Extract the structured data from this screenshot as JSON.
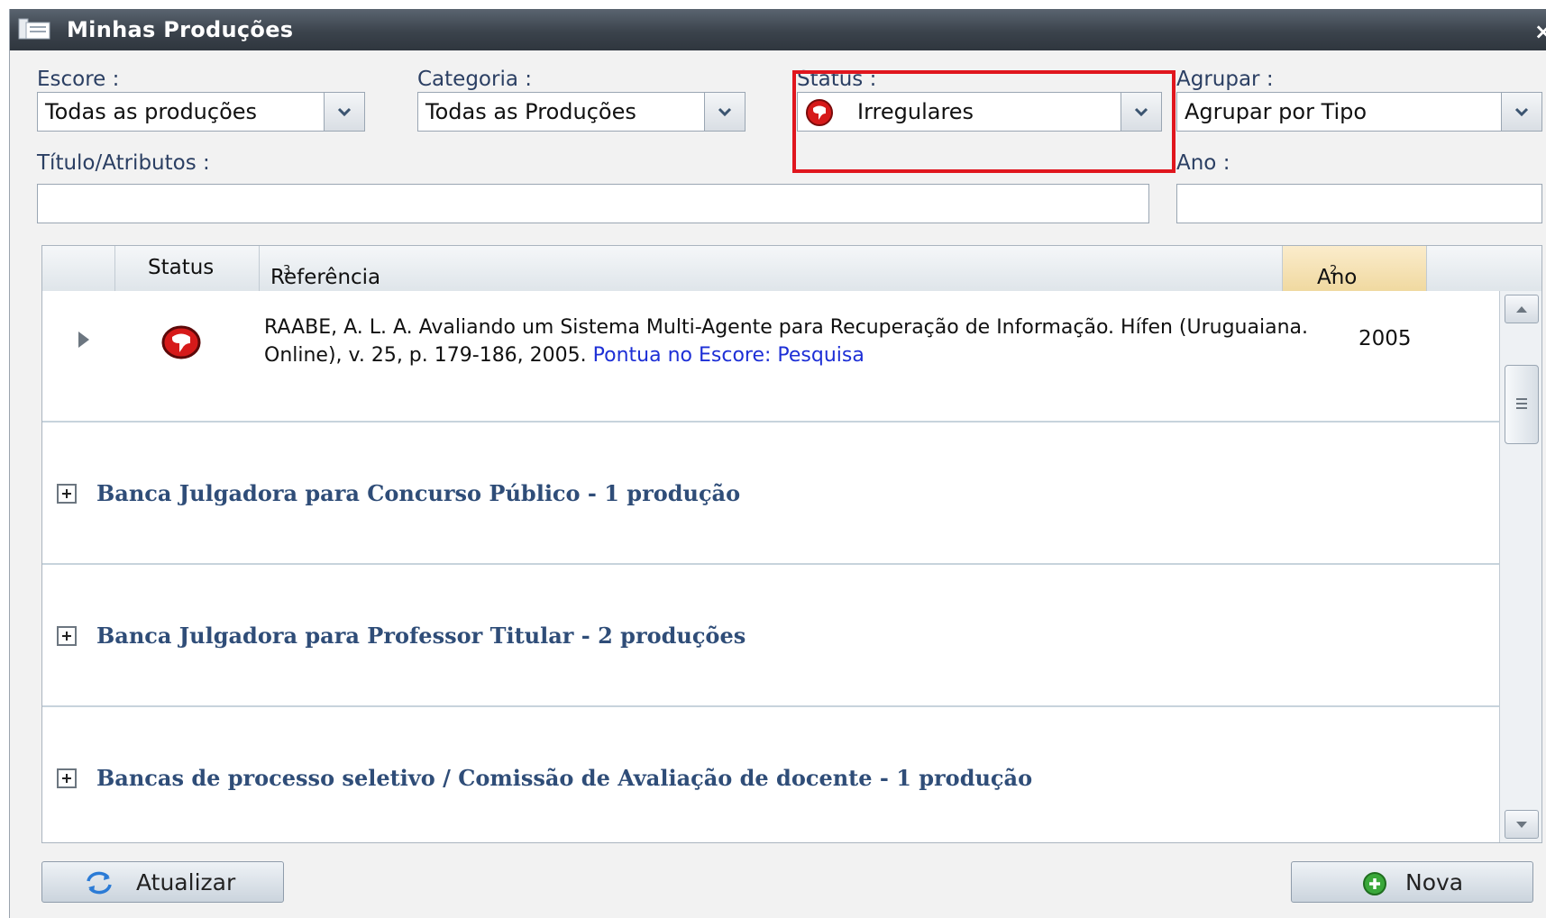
{
  "window": {
    "title": "Minhas Produções",
    "close_glyph": "×"
  },
  "filters": {
    "escore": {
      "label": "Escore :",
      "value": "Todas as produções"
    },
    "categoria": {
      "label": "Categoria :",
      "value": "Todas as Produções"
    },
    "status": {
      "label": "Status :",
      "value": "Irregulares",
      "icon": "irregular-status-icon"
    },
    "agrupar": {
      "label": "Agrupar :",
      "value": "Agrupar por Tipo"
    },
    "titulo": {
      "label": "Título/Atributos :",
      "value": ""
    },
    "ano": {
      "label": "Ano :",
      "value": ""
    }
  },
  "grid": {
    "columns": [
      {
        "label": ""
      },
      {
        "label": "Status"
      },
      {
        "label": "Referência",
        "sort_index": "3"
      },
      {
        "label": "Ano",
        "sort_index": "2"
      }
    ],
    "rows": [
      {
        "status_icon": "irregular-status-icon",
        "reference": "RAABE, A. L. A. Avaliando um Sistema Multi-Agente para Recuperação de Informação. Hífen (Uruguaiana. Online), v. 25, p. 179-186, 2005.",
        "link": "Pontua no Escore: Pesquisa",
        "year": "2005"
      }
    ],
    "groups": [
      {
        "label": "Banca Julgadora para Concurso Público - 1 produção"
      },
      {
        "label": "Banca Julgadora para Professor Titular - 2 produções"
      },
      {
        "label": "Bancas de processo seletivo / Comissão de Avaliação de docente - 1 produção"
      }
    ]
  },
  "buttons": {
    "refresh": {
      "label": "Atualizar",
      "icon": "refresh-icon"
    },
    "new": {
      "label": "Nova",
      "icon": "add-icon"
    }
  },
  "colors": {
    "highlight": "#e0161e",
    "link": "#1d2fd6",
    "group_text": "#2f4d78",
    "title_bar": "#3b434c"
  }
}
